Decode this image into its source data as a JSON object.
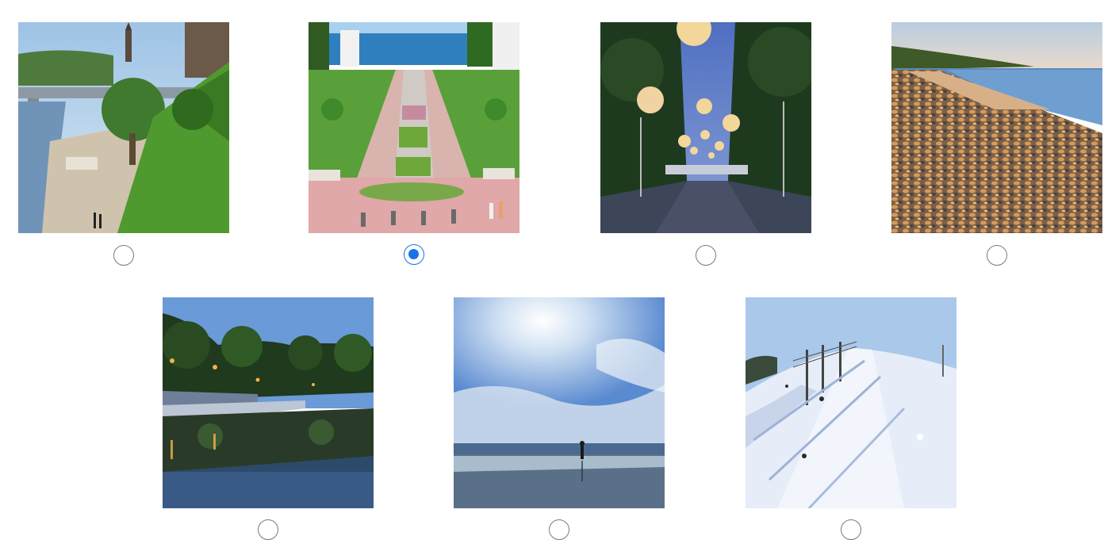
{
  "image_choice": {
    "options": [
      {
        "image": "river-bridge-promenade-photo",
        "selected": false
      },
      {
        "image": "seaside-promenade-park-photo",
        "selected": true
      },
      {
        "image": "lantern-lit-alley-night-photo",
        "selected": false
      },
      {
        "image": "pebble-beach-sunset-photo",
        "selected": false
      },
      {
        "image": "lake-dusk-reflection-photo",
        "selected": false
      },
      {
        "image": "sunny-beach-person-photo",
        "selected": false
      },
      {
        "image": "ski-slope-lift-photo",
        "selected": false
      }
    ],
    "colors": {
      "radio_border": "#7a7a7a",
      "radio_selected": "#1a73e8"
    }
  }
}
